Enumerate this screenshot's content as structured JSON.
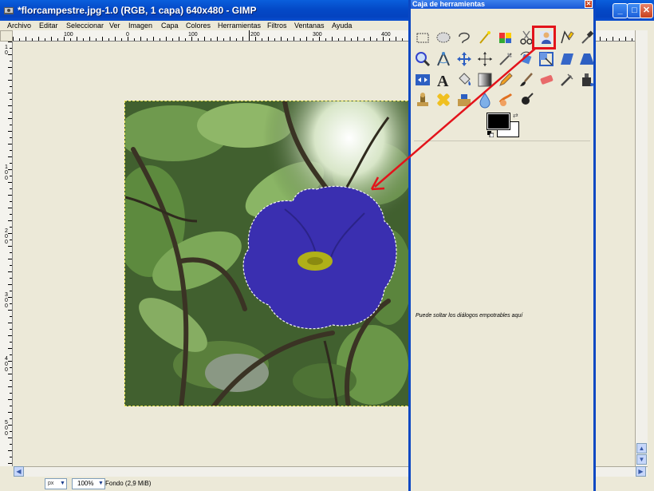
{
  "main_window": {
    "title": "*florcampestre.jpg-1.0 (RGB, 1 capa) 640x480 - GIMP",
    "buttons": {
      "minimize": "_",
      "maximize": "□",
      "close": "✕"
    }
  },
  "menu": {
    "items": [
      {
        "label": "Archivo"
      },
      {
        "label": "Editar"
      },
      {
        "label": "Seleccionar"
      },
      {
        "label": "Ver"
      },
      {
        "label": "Imagen"
      },
      {
        "label": "Capa"
      },
      {
        "label": "Colores"
      },
      {
        "label": "Herramientas"
      },
      {
        "label": "Filtros"
      },
      {
        "label": "Ventanas"
      },
      {
        "label": "Ayuda"
      }
    ]
  },
  "rulers": {
    "top_labels": [
      "100",
      "0",
      "100",
      "200",
      "300",
      "400",
      "800"
    ],
    "left_labels": [
      "1\n0",
      "1\n0\n0",
      "2\n0\n0",
      "3\n0\n0",
      "4\n0\n0",
      "5\n0\n0"
    ]
  },
  "statusbar": {
    "unit": "px",
    "zoom": "100%",
    "layer_info": "Fondo (2,9 MiB)"
  },
  "toolbox": {
    "title": "Caja de herramientas",
    "close": "✕",
    "dock_hint": "Puede soltar los diálogos empotrables aquí",
    "active_tool": "foreground-select-icon",
    "foreground_color": "#000000",
    "background_color": "#ffffff"
  },
  "colors": {
    "titlebar": "#0449c7",
    "highlight": "#e3131b",
    "flower": "#3a2fb0",
    "flower_center": "#b0b018"
  }
}
